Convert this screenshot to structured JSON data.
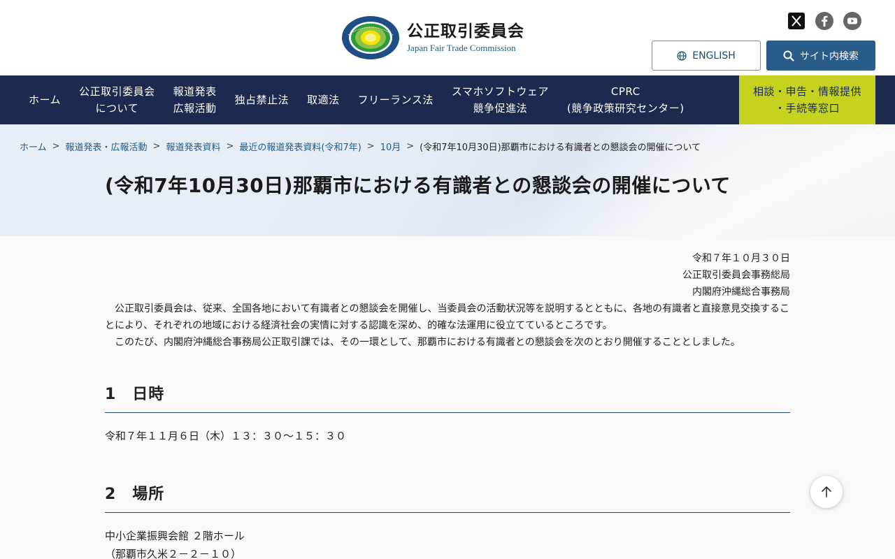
{
  "header": {
    "org_name_jp": "公正取引委員会",
    "org_name_en": "Japan Fair Trade Commission",
    "logo_ring_text": "JAPAN FAIR TRADE COMMISSION",
    "english_button": "ENGLISH",
    "search_button": "サイト内検索",
    "social_icons": [
      "x-icon",
      "facebook-icon",
      "youtube-icon"
    ]
  },
  "nav": {
    "items": [
      {
        "line1": "ホーム",
        "line2": ""
      },
      {
        "line1": "公正取引委員会",
        "line2": "について"
      },
      {
        "line1": "報道発表",
        "line2": "広報活動"
      },
      {
        "line1": "独占禁止法",
        "line2": ""
      },
      {
        "line1": "取適法",
        "line2": ""
      },
      {
        "line1": "フリーランス法",
        "line2": ""
      },
      {
        "line1": "スマホソフトウェア",
        "line2": "競争促進法"
      },
      {
        "line1": "CPRC",
        "line2": "(競争政策研究センター)"
      }
    ],
    "consult": {
      "line1": "相談・申告・情報提供",
      "line2": "・手続等窓口"
    }
  },
  "breadcrumb": {
    "items": [
      "ホーム",
      "報道発表・広報活動",
      "報道発表資料",
      "最近の報道発表資料(令和7年)",
      "10月"
    ],
    "separator": ">",
    "current": "(令和7年10月30日)那覇市における有識者との懇談会の開催について"
  },
  "page": {
    "title": "(令和7年10月30日)那覇市における有識者との懇談会の開催について",
    "date": "令和７年１０月３０日",
    "issuer1": "公正取引委員会事務総局",
    "issuer2": "内閣府沖縄総合事務局",
    "para1": "公正取引委員会は、従来、全国各地において有識者との懇談会を開催し、当委員会の活動状況等を説明するとともに、各地の有識者と直接意見交換することにより、それぞれの地域における経済社会の実情に対する認識を深め、的確な法運用に役立てているところです。",
    "para2": "このたび、内閣府沖縄総合事務局公正取引課では、その一環として、那覇市における有識者との懇談会を次のとおり開催することとしました。",
    "sections": [
      {
        "heading": "1　日時",
        "lines": [
          "令和７年１１月６日（木）１３：３０～１５：３０"
        ]
      },
      {
        "heading": "2　場所",
        "lines": [
          "中小企業振興会館 ２階ホール",
          "（那覇市久米２－２－１０）"
        ]
      }
    ]
  },
  "colors": {
    "nav_bg": "#1b2a4e",
    "consult_bg": "#c6d21d",
    "search_btn_bg": "#2a5c8a",
    "link": "#1f5a8c"
  }
}
